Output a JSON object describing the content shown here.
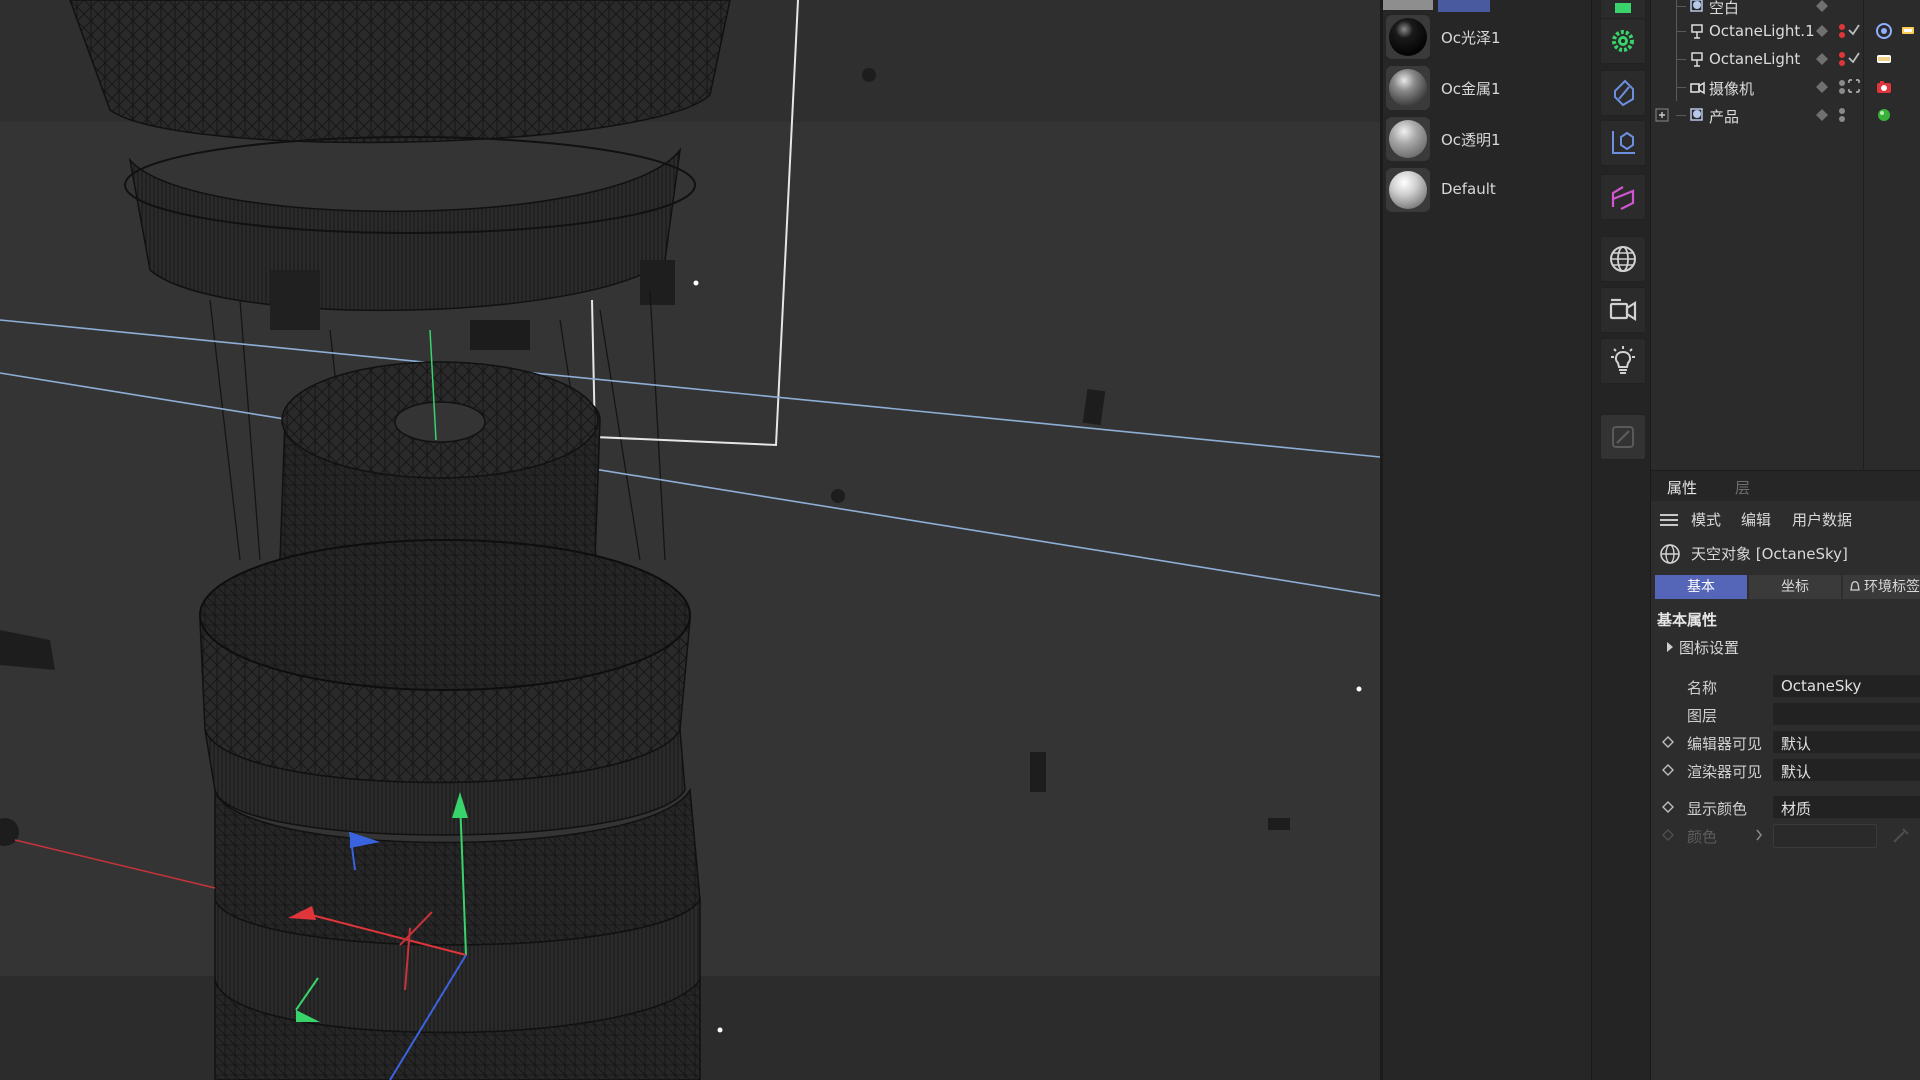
{
  "materials": [
    {
      "name": "Oc光泽1",
      "ball": "dark-glossy"
    },
    {
      "name": "Oc金属1",
      "ball": "metal"
    },
    {
      "name": "Oc透明1",
      "ball": "transparent"
    },
    {
      "name": "Default",
      "ball": "default-white"
    }
  ],
  "toolbar": {
    "icons": [
      "green-cube-icon",
      "gear-icon",
      "deformer-icon",
      "coordinate-icon",
      "spline-tool-icon",
      "globe-icon",
      "camera-icon",
      "light-bulb-icon",
      "edit-pen-icon"
    ]
  },
  "objects": [
    {
      "name": "空白",
      "icon": "null-object-icon",
      "partial": true
    },
    {
      "name": "OctaneLight.1",
      "icon": "octane-light-icon",
      "tag": "target-tag-icon"
    },
    {
      "name": "OctaneLight",
      "icon": "octane-light-icon",
      "tag": "light-tag-icon"
    },
    {
      "name": "摄像机",
      "icon": "camera-object-icon",
      "tag": "octane-camera-tag-icon"
    },
    {
      "name": "产品",
      "icon": "null-object-icon",
      "tag": "green-material-tag-icon"
    }
  ],
  "attributes": {
    "tabs": [
      "属性",
      "层"
    ],
    "menu": [
      "模式",
      "编辑",
      "用户数据"
    ],
    "object_label": "天空对象 [OctaneSky]",
    "subtabs": [
      "基本",
      "坐标",
      "环境标签"
    ],
    "section_title": "基本属性",
    "icon_settings": "图标设置",
    "props": [
      {
        "label": "名称",
        "value": "OctaneSky"
      },
      {
        "label": "图层",
        "value": ""
      },
      {
        "label": "编辑器可见",
        "value": "默认"
      },
      {
        "label": "渲染器可见",
        "value": "默认"
      },
      {
        "label": "显示颜色",
        "value": "材质"
      },
      {
        "label": "颜色",
        "value": ""
      }
    ]
  },
  "colors": {
    "accent": "#5566b8",
    "axis_x": "#e0353a",
    "axis_y": "#39d36b",
    "axis_z": "#3a63e0",
    "guide_line": "#8eaed6"
  }
}
